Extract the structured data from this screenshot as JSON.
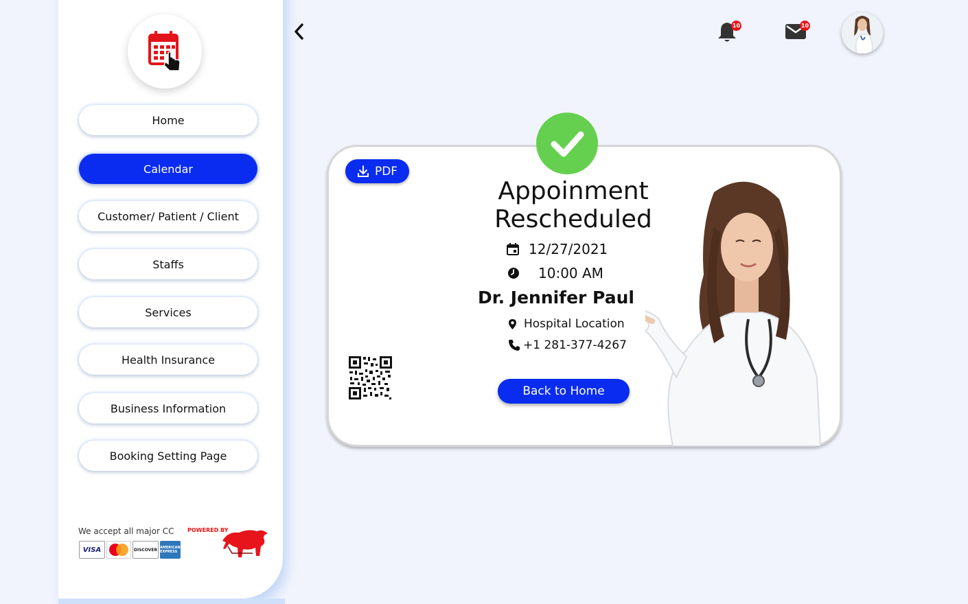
{
  "sidebar": {
    "nav": [
      {
        "label": "Home",
        "active": false
      },
      {
        "label": "Calendar",
        "active": true
      },
      {
        "label": "Customer/ Patient / Client",
        "active": false
      },
      {
        "label": "Staffs",
        "active": false
      },
      {
        "label": "Services",
        "active": false
      },
      {
        "label": "Health Insurance",
        "active": false
      },
      {
        "label": "Business Information",
        "active": false
      },
      {
        "label": "Booking Setting Page",
        "active": false
      }
    ],
    "cc_text": "We accept all major CC",
    "cards": {
      "visa": "VISA",
      "discover": "DISCOVER",
      "amex": "AMERICAN EXPRESS"
    },
    "powered_by": "POWERED BY"
  },
  "topbar": {
    "notifications_count": "10",
    "messages_count": "10"
  },
  "appointment": {
    "pdf_label": "PDF",
    "title_line1": "Appoinment",
    "title_line2": "Rescheduled",
    "date": "12/27/2021",
    "time": "10:00 AM",
    "doctor": "Dr. Jennifer Paul",
    "location": "Hospital Location",
    "phone": "+1 281-377-4267",
    "back_label": "Back to Home"
  },
  "colors": {
    "primary": "#0a2cf0",
    "success": "#65d04f",
    "badge": "#e8141b",
    "background": "#f1f4fc"
  }
}
